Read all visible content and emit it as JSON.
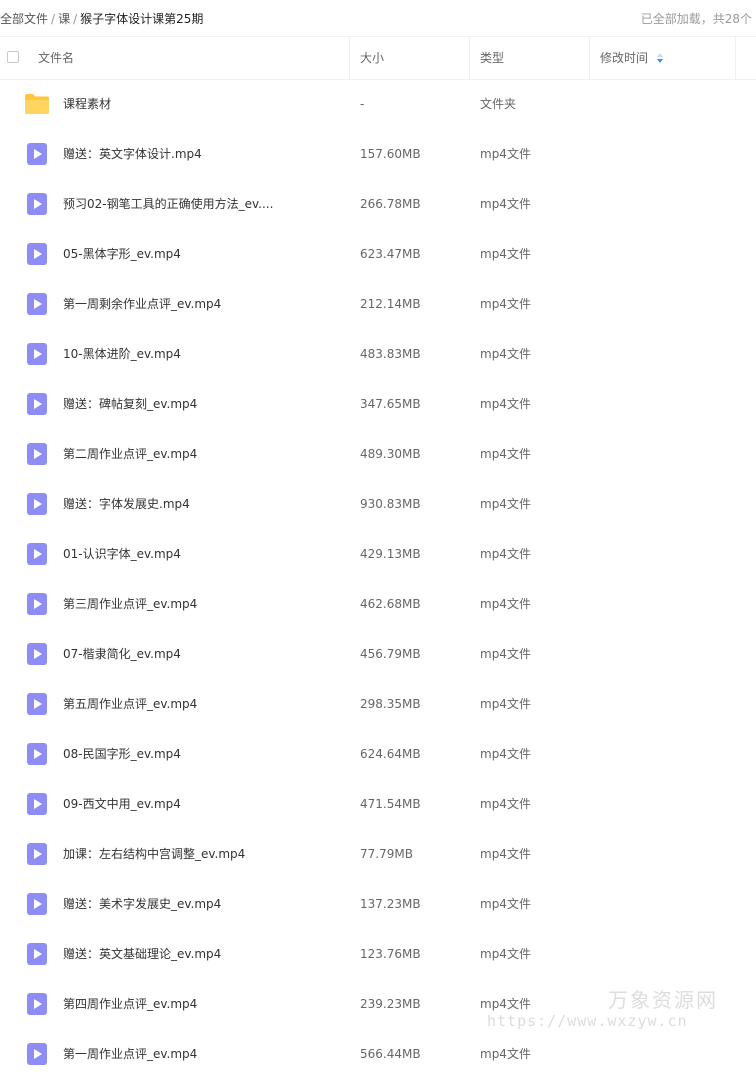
{
  "breadcrumb": {
    "items": [
      "全部文件",
      "课",
      "猴子字体设计课第25期"
    ],
    "separator": "/"
  },
  "load_status": "已全部加载，共28个",
  "columns": {
    "name": "文件名",
    "size": "大小",
    "type": "类型",
    "modified": "修改时间"
  },
  "colors": {
    "folder": "#FFC63A",
    "video": "#8E8CF5",
    "sort_indicator": "#3C8CF6"
  },
  "files": [
    {
      "name": "课程素材",
      "size": "-",
      "type": "文件夹",
      "icon": "folder-icon"
    },
    {
      "name": "赠送：英文字体设计.mp4",
      "size": "157.60MB",
      "type": "mp4文件",
      "icon": "video-file-icon"
    },
    {
      "name": "预习02-钢笔工具的正确使用方法_ev....",
      "size": "266.78MB",
      "type": "mp4文件",
      "icon": "video-file-icon"
    },
    {
      "name": "05-黑体字形_ev.mp4",
      "size": "623.47MB",
      "type": "mp4文件",
      "icon": "video-file-icon"
    },
    {
      "name": "第一周剩余作业点评_ev.mp4",
      "size": "212.14MB",
      "type": "mp4文件",
      "icon": "video-file-icon"
    },
    {
      "name": "10-黑体进阶_ev.mp4",
      "size": "483.83MB",
      "type": "mp4文件",
      "icon": "video-file-icon"
    },
    {
      "name": "赠送：碑帖复刻_ev.mp4",
      "size": "347.65MB",
      "type": "mp4文件",
      "icon": "video-file-icon"
    },
    {
      "name": "第二周作业点评_ev.mp4",
      "size": "489.30MB",
      "type": "mp4文件",
      "icon": "video-file-icon"
    },
    {
      "name": "赠送：字体发展史.mp4",
      "size": "930.83MB",
      "type": "mp4文件",
      "icon": "video-file-icon"
    },
    {
      "name": "01-认识字体_ev.mp4",
      "size": "429.13MB",
      "type": "mp4文件",
      "icon": "video-file-icon"
    },
    {
      "name": "第三周作业点评_ev.mp4",
      "size": "462.68MB",
      "type": "mp4文件",
      "icon": "video-file-icon"
    },
    {
      "name": "07-楷隶简化_ev.mp4",
      "size": "456.79MB",
      "type": "mp4文件",
      "icon": "video-file-icon"
    },
    {
      "name": "第五周作业点评_ev.mp4",
      "size": "298.35MB",
      "type": "mp4文件",
      "icon": "video-file-icon"
    },
    {
      "name": "08-民国字形_ev.mp4",
      "size": "624.64MB",
      "type": "mp4文件",
      "icon": "video-file-icon"
    },
    {
      "name": "09-西文中用_ev.mp4",
      "size": "471.54MB",
      "type": "mp4文件",
      "icon": "video-file-icon"
    },
    {
      "name": "加课：左右结构中宫调整_ev.mp4",
      "size": "77.79MB",
      "type": "mp4文件",
      "icon": "video-file-icon"
    },
    {
      "name": "赠送：美术字发展史_ev.mp4",
      "size": "137.23MB",
      "type": "mp4文件",
      "icon": "video-file-icon"
    },
    {
      "name": "赠送：英文基础理论_ev.mp4",
      "size": "123.76MB",
      "type": "mp4文件",
      "icon": "video-file-icon"
    },
    {
      "name": "第四周作业点评_ev.mp4",
      "size": "239.23MB",
      "type": "mp4文件",
      "icon": "video-file-icon"
    },
    {
      "name": "第一周作业点评_ev.mp4",
      "size": "566.44MB",
      "type": "mp4文件",
      "icon": "video-file-icon"
    }
  ],
  "watermark": {
    "title": "万象资源网",
    "url": "https://www.wxzyw.cn"
  }
}
